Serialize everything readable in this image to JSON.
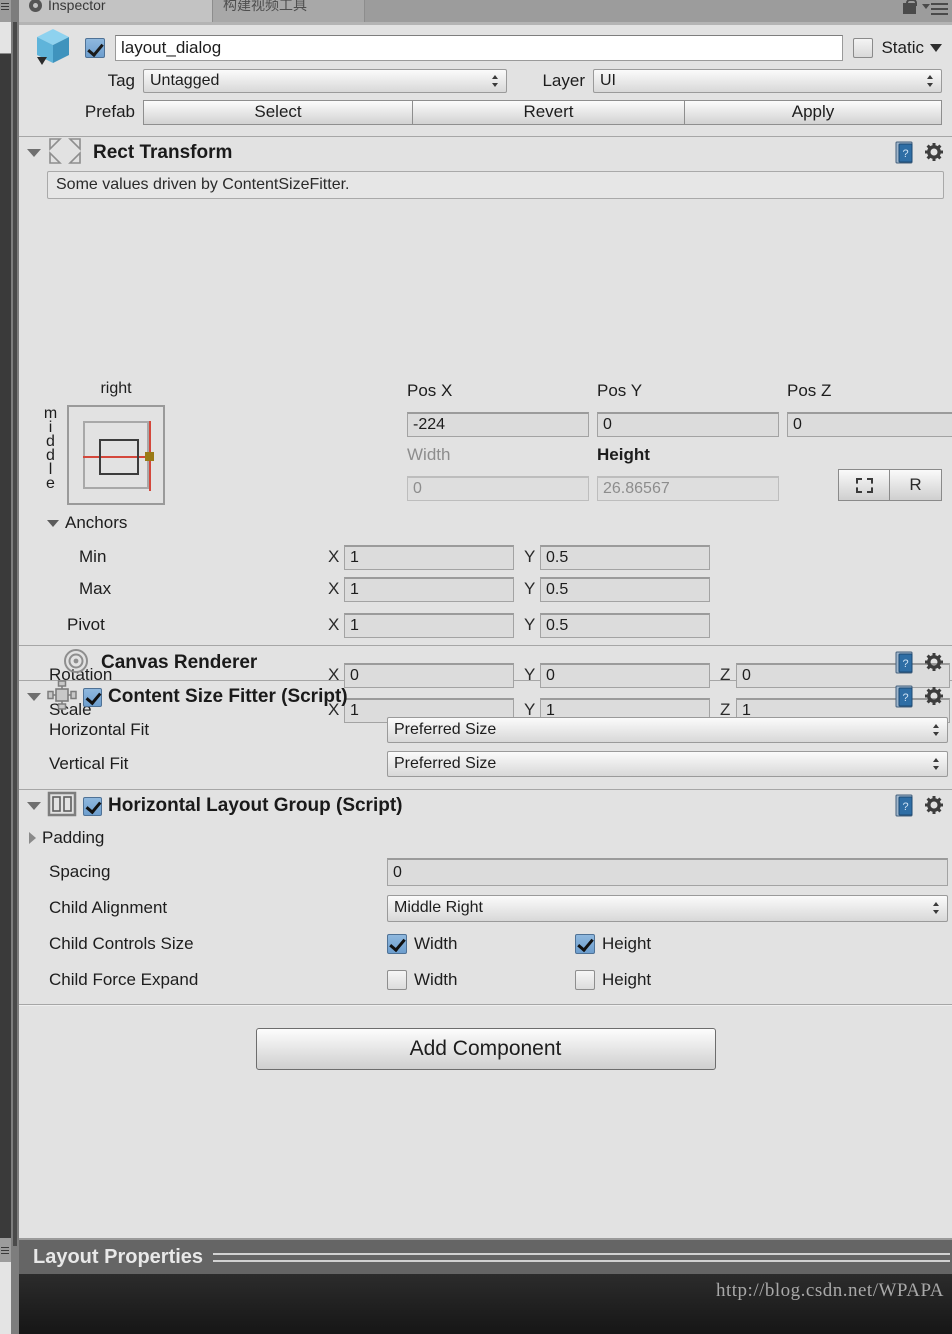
{
  "window": {
    "tabs": [
      {
        "label": "Inspector",
        "icon": "inspector-icon",
        "active": true
      },
      {
        "label": "构建视频工具",
        "icon": "",
        "active": false
      }
    ],
    "lock_icon": "lock-icon",
    "menu_icon": "hamburger-menu-icon"
  },
  "object_header": {
    "prefab_icon": "prefab-cube-icon",
    "enabled_checkbox": true,
    "name": "layout_dialog",
    "static_label": "Static",
    "static_checked": false,
    "tag_label": "Tag",
    "tag_value": "Untagged",
    "layer_label": "Layer",
    "layer_value": "UI",
    "prefab_label": "Prefab",
    "prefab_buttons": [
      "Select",
      "Revert",
      "Apply"
    ]
  },
  "rect_transform": {
    "title": "Rect Transform",
    "icon": "rect-transform-icon",
    "help_icon": "help-book-icon",
    "gear_icon": "gear-icon",
    "info": "Some values driven by ContentSizeFitter.",
    "anchor_preset": {
      "horizontal": "right",
      "vertical": "middle"
    },
    "pos_headers": [
      "Pos X",
      "Pos Y",
      "Pos Z"
    ],
    "pos_values": [
      "-224",
      "0",
      "0"
    ],
    "size_headers": [
      "Width",
      "Height"
    ],
    "size_values": [
      "0",
      "26.86567"
    ],
    "blueprint_button": "blueprint-mode-icon",
    "raw_button": "R",
    "anchors_label": "Anchors",
    "anchor_rows": [
      {
        "label": "Min",
        "x_axis": "X",
        "x": "1",
        "y_axis": "Y",
        "y": "0.5"
      },
      {
        "label": "Max",
        "x_axis": "X",
        "x": "1",
        "y_axis": "Y",
        "y": "0.5"
      },
      {
        "label": "Pivot",
        "x_axis": "X",
        "x": "1",
        "y_axis": "Y",
        "y": "0.5"
      }
    ],
    "transform_rows": [
      {
        "label": "Rotation",
        "x_axis": "X",
        "x": "0",
        "y_axis": "Y",
        "y": "0",
        "z_axis": "Z",
        "z": "0"
      },
      {
        "label": "Scale",
        "x_axis": "X",
        "x": "1",
        "y_axis": "Y",
        "y": "1",
        "z_axis": "Z",
        "z": "1"
      }
    ]
  },
  "canvas_renderer": {
    "title": "Canvas Renderer",
    "icon": "canvas-renderer-icon",
    "help_icon": "help-book-icon",
    "gear_icon": "gear-icon"
  },
  "content_size_fitter": {
    "title": "Content Size Fitter (Script)",
    "icon": "content-size-fitter-icon",
    "enabled": true,
    "help_icon": "help-book-icon",
    "gear_icon": "gear-icon",
    "rows": [
      {
        "label": "Horizontal Fit",
        "value": "Preferred Size"
      },
      {
        "label": "Vertical Fit",
        "value": "Preferred Size"
      }
    ]
  },
  "horizontal_layout_group": {
    "title": "Horizontal Layout Group (Script)",
    "icon": "horizontal-layout-group-icon",
    "enabled": true,
    "help_icon": "help-book-icon",
    "gear_icon": "gear-icon",
    "padding_label": "Padding",
    "spacing_label": "Spacing",
    "spacing_value": "0",
    "child_alignment_label": "Child Alignment",
    "child_alignment_value": "Middle Right",
    "child_controls_size_label": "Child Controls Size",
    "child_controls_width_label": "Width",
    "child_controls_width": true,
    "child_controls_height_label": "Height",
    "child_controls_height": true,
    "child_force_expand_label": "Child Force Expand",
    "child_force_width_label": "Width",
    "child_force_width": false,
    "child_force_height_label": "Height",
    "child_force_height": false
  },
  "add_component": {
    "label": "Add Component"
  },
  "bottom": {
    "layout_properties_title": "Layout Properties",
    "watermark": "http://blog.csdn.net/WPAPA"
  },
  "colors": {
    "panel_bg": "#e2e2e2",
    "tab_active": "#c3c3c3",
    "tab_bar": "#9c9c9c",
    "accent_blue": "#6d9ece",
    "anchor_red": "#d4473b",
    "anchor_dot": "#9a7a16",
    "footer_bar": "#656565",
    "console_bg": "#1e1e1e"
  }
}
